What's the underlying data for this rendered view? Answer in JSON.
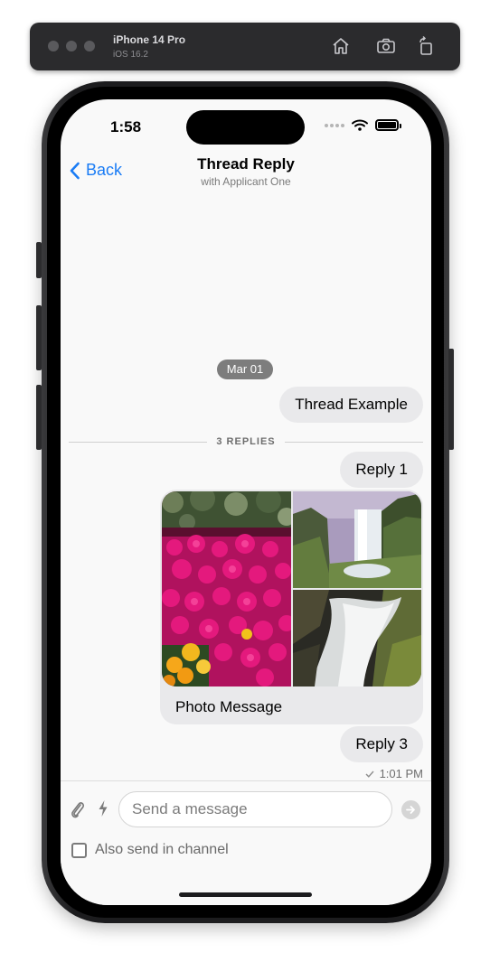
{
  "simulator": {
    "device_name": "iPhone 14 Pro",
    "os_version": "iOS 16.2",
    "icons": [
      "home-icon",
      "screenshot-icon",
      "rotate-icon"
    ]
  },
  "status_bar": {
    "time": "1:58",
    "icons": [
      "signal-icon",
      "wifi-icon",
      "battery-icon"
    ]
  },
  "nav": {
    "back_label": "Back",
    "title": "Thread Reply",
    "subtitle": "with Applicant One"
  },
  "thread": {
    "date_separator": "Mar 01",
    "parent_message": "Thread Example",
    "replies_divider": "3 REPLIES",
    "replies": [
      {
        "type": "text",
        "text": "Reply 1"
      },
      {
        "type": "photos",
        "caption": "Photo Message",
        "photos": [
          "flowers-photo",
          "waterfall-photo",
          "river-rapids-photo"
        ]
      },
      {
        "type": "text",
        "text": "Reply 3"
      }
    ],
    "last_timestamp": "1:01 PM",
    "delivery_status_icon": "checkmark-icon"
  },
  "composer": {
    "placeholder": "Send a message",
    "value": "",
    "also_send_label": "Also send in channel",
    "also_send_checked": false,
    "icons": [
      "paperclip-icon",
      "lightning-icon",
      "send-arrow-icon"
    ]
  },
  "colors": {
    "accent": "#1a7cf5",
    "bubble": "#e9e9eb",
    "date_pill": "#7d7d7d"
  }
}
